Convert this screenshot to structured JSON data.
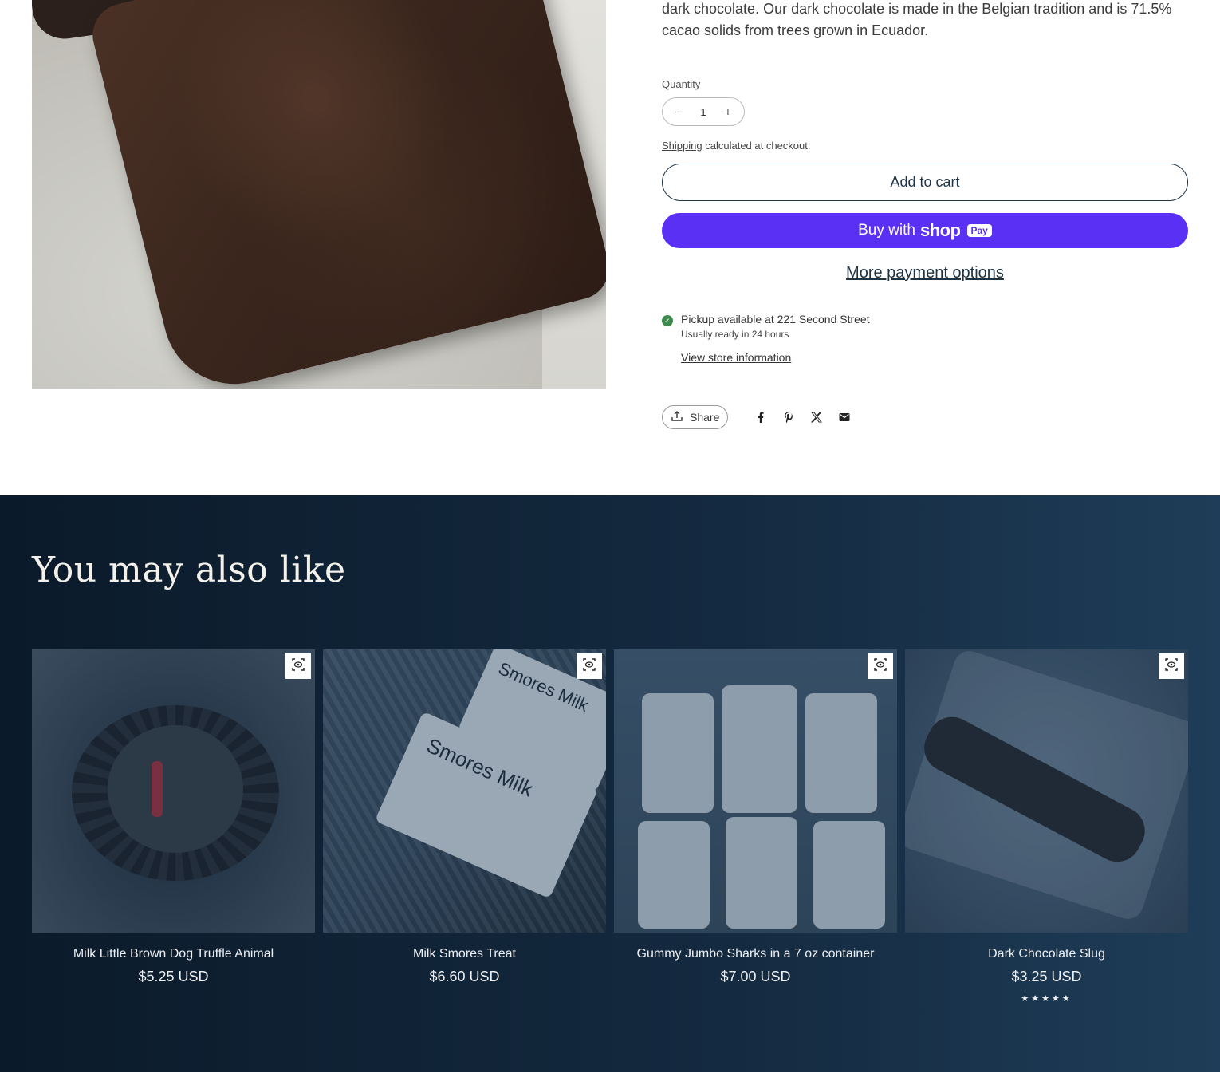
{
  "product": {
    "description": "dark chocolate. Our dark chocolate is made in the Belgian tradition and is 71.5% cacao solids from trees grown in Ecuador.",
    "quantity_label": "Quantity",
    "quantity_value": "1",
    "decrease_symbol": "−",
    "increase_symbol": "+",
    "shipping_link": "Shipping",
    "shipping_rest": "calculated at checkout.",
    "add_to_cart": "Add to cart",
    "buy_with": "Buy with",
    "shop_word": "shop",
    "pay_badge": "Pay",
    "more_payment": "More payment options",
    "pickup_title": "Pickup available at 221 Second Street",
    "pickup_sub": "Usually ready in 24 hours",
    "store_link": "View store information",
    "share_label": "Share"
  },
  "related": {
    "heading": "You may also like",
    "items": [
      {
        "title": "Milk Little Brown Dog Truffle Animal",
        "price": "$5.25 USD"
      },
      {
        "title": "Milk Smores Treat",
        "price": "$6.60 USD"
      },
      {
        "title": "Gummy Jumbo Sharks in a 7 oz container",
        "price": "$7.00 USD"
      },
      {
        "title": "Dark Chocolate Slug",
        "price": "$3.25 USD",
        "stars": "★★★★★"
      }
    ],
    "labels": {
      "smores_1": "Smores Milk",
      "smores_2": "Smores Milk"
    }
  },
  "colors": {
    "shop_pay": "#5a31f4",
    "button_border": "#1e3344",
    "pickup_check": "#3d8a4c",
    "related_bg": "#142a40"
  },
  "icons": [
    "minus-icon",
    "plus-icon",
    "check-icon",
    "share-icon",
    "facebook-icon",
    "pinterest-icon",
    "x-icon",
    "email-icon",
    "quick-view-icon"
  ]
}
